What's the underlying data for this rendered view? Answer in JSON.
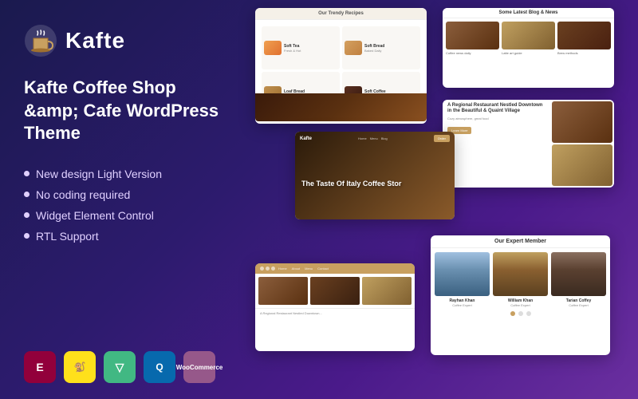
{
  "brand": {
    "name": "Kafte",
    "logo_icon": "coffee-cup"
  },
  "theme_title": "Kafte Coffee Shop &amp; Cafe WordPress Theme",
  "features": [
    "New design Light Version",
    "No coding required",
    "Widget Element Control",
    "RTL Support"
  ],
  "badges": [
    {
      "id": "elementor",
      "label": "E",
      "title": "Elementor"
    },
    {
      "id": "mailchimp",
      "label": "🐵",
      "title": "Mailchimp"
    },
    {
      "id": "vue",
      "label": "V",
      "title": "Vue"
    },
    {
      "id": "query",
      "label": "Q",
      "title": "jQuery"
    },
    {
      "id": "woo",
      "label": "Woo",
      "title": "WooCommerce"
    }
  ],
  "screenshots": {
    "recipes": {
      "title": "Our Trendy Recipes",
      "items": [
        {
          "name": "Soft Tea",
          "color": "food-soft-tea"
        },
        {
          "name": "Soft Bread",
          "color": "food-soft-bread"
        },
        {
          "name": "Loaf Bread",
          "color": "food-loaf-bread"
        },
        {
          "name": "Soft Coffee",
          "color": "food-soft-coffee"
        }
      ]
    },
    "blog": {
      "title": "Some Latest Blog & News"
    },
    "hero": {
      "logo": "Kafte",
      "headline": "The Taste Of Italy Coffee Stor"
    },
    "restaurant": {
      "title": "A Regional Restaurant Nestled Downtown in the Beautiful & Quaint Village",
      "button": "Learn More"
    },
    "team": {
      "title": "Our Expert Member",
      "members": [
        {
          "name": "Rayhan Khan",
          "role": "Coffee Expert"
        },
        {
          "name": "William Khan",
          "role": "Coffee Expert"
        },
        {
          "name": "Tarian Coffey",
          "role": "Coffee Expert"
        }
      ]
    }
  }
}
